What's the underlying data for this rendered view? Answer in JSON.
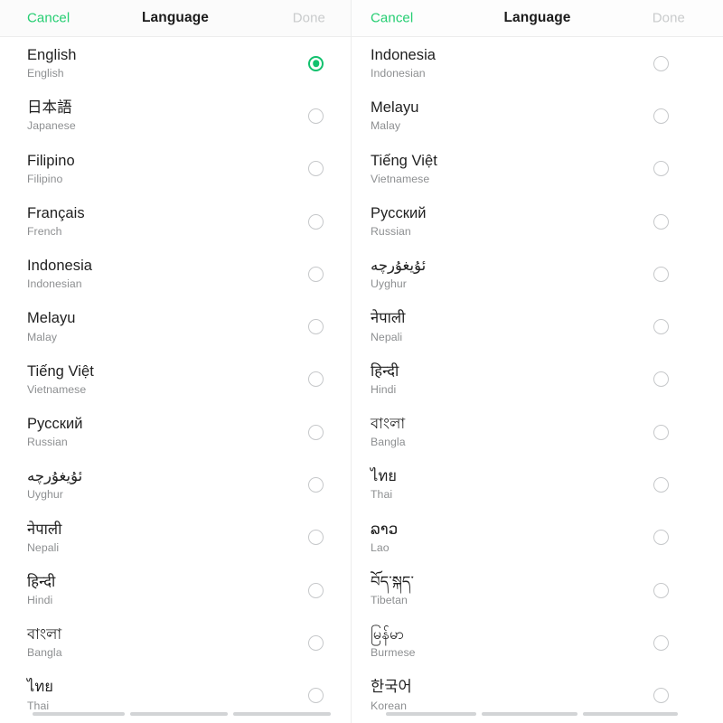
{
  "colors": {
    "accent_green": "#12c16e",
    "cancel_green": "#25ce72",
    "done_disabled": "#c9cbcc",
    "title_black": "#1b1b1b",
    "native_text": "#1f1f1f",
    "english_text": "#8d8f91",
    "radio_border": "#c6c8ca",
    "divider": "#ededed",
    "panel_bg": "#ffffff",
    "navbar_bg": "#fbfbfb",
    "gesture_bar": "#d2d4d6"
  },
  "panels": [
    {
      "id": "left-panel",
      "header": {
        "cancel_label": "Cancel",
        "title": "Language",
        "done_label": "Done",
        "done_enabled": false
      },
      "scroll_position": "top",
      "items": [
        {
          "native": "English",
          "english": "English",
          "selected": true
        },
        {
          "native": "日本語",
          "english": "Japanese",
          "selected": false
        },
        {
          "native": "Filipino",
          "english": "Filipino",
          "selected": false
        },
        {
          "native": "Français",
          "english": "French",
          "selected": false
        },
        {
          "native": "Indonesia",
          "english": "Indonesian",
          "selected": false
        },
        {
          "native": "Melayu",
          "english": "Malay",
          "selected": false
        },
        {
          "native": "Tiếng Việt",
          "english": "Vietnamese",
          "selected": false
        },
        {
          "native": "Русский",
          "english": "Russian",
          "selected": false
        },
        {
          "native": "ئۇيغۇرچە",
          "english": "Uyghur",
          "selected": false
        },
        {
          "native": "नेपाली",
          "english": "Nepali",
          "selected": false
        },
        {
          "native": "हिन्दी",
          "english": "Hindi",
          "selected": false
        },
        {
          "native": "বাংলা",
          "english": "Bangla",
          "selected": false
        },
        {
          "native": "ไทย",
          "english": "Thai",
          "selected": false
        }
      ],
      "gesture_nav": {
        "back": "back-bar",
        "home": "home-bar",
        "recents": "recents-bar"
      }
    },
    {
      "id": "right-panel",
      "header": {
        "cancel_label": "Cancel",
        "title": "Language",
        "done_label": "Done",
        "done_enabled": false
      },
      "scroll_position": "scrolled",
      "items": [
        {
          "native": "Indonesia",
          "english": "Indonesian",
          "selected": false
        },
        {
          "native": "Melayu",
          "english": "Malay",
          "selected": false
        },
        {
          "native": "Tiếng Việt",
          "english": "Vietnamese",
          "selected": false
        },
        {
          "native": "Русский",
          "english": "Russian",
          "selected": false
        },
        {
          "native": "ئۇيغۇرچە",
          "english": "Uyghur",
          "selected": false
        },
        {
          "native": "नेपाली",
          "english": "Nepali",
          "selected": false
        },
        {
          "native": "हिन्दी",
          "english": "Hindi",
          "selected": false
        },
        {
          "native": "বাংলা",
          "english": "Bangla",
          "selected": false
        },
        {
          "native": "ไทย",
          "english": "Thai",
          "selected": false
        },
        {
          "native": "ລາວ",
          "english": "Lao",
          "selected": false
        },
        {
          "native": "བོད་སྐད་",
          "english": "Tibetan",
          "selected": false
        },
        {
          "native": "မြန်မာ",
          "english": "Burmese",
          "selected": false
        },
        {
          "native": "한국어",
          "english": "Korean",
          "selected": false
        }
      ],
      "gesture_nav": {
        "back": "back-bar",
        "home": "home-bar",
        "recents": "recents-bar"
      }
    }
  ]
}
